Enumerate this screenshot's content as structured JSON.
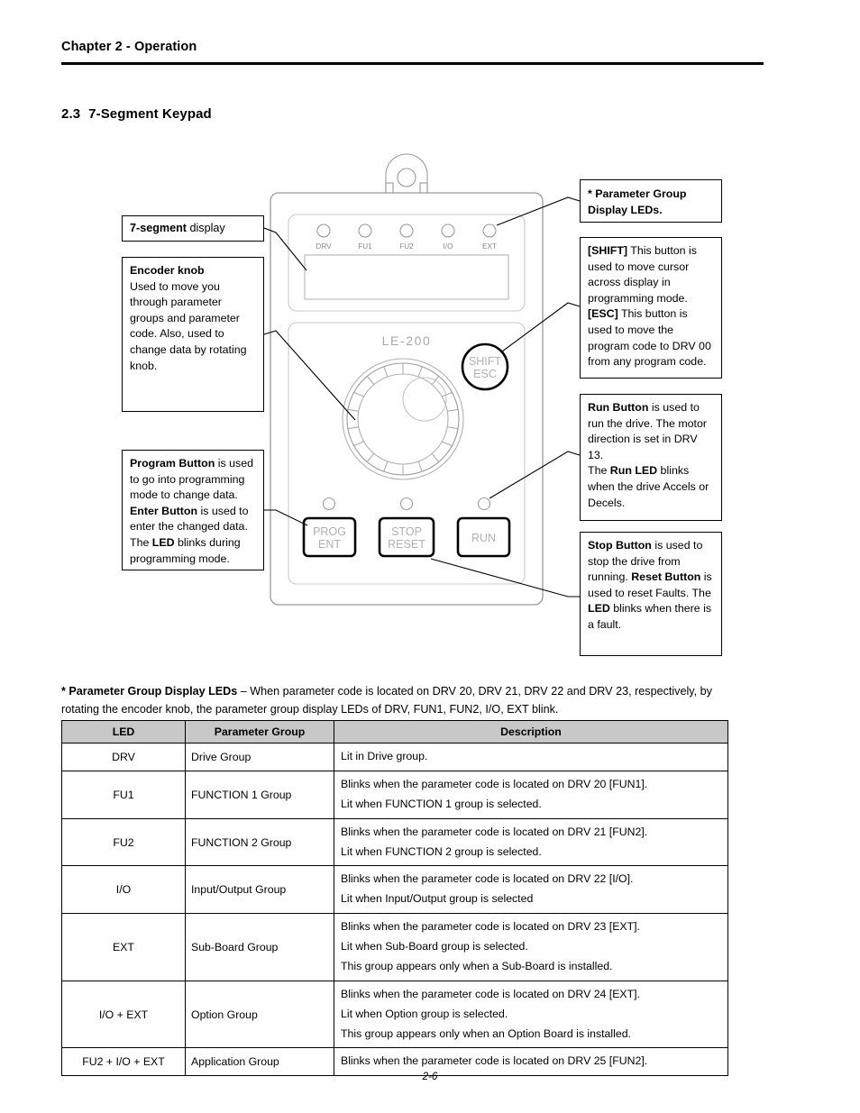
{
  "header": {
    "chapter": "Chapter 2 - Operation"
  },
  "section": {
    "number": "2.3",
    "title": "7-Segment Keypad"
  },
  "callouts": {
    "seven_segment": {
      "bold": "7-segment",
      "rest": " display"
    },
    "encoder_knob": {
      "title": "Encoder knob",
      "body": "Used to move you through parameter groups and parameter code. Also, used to change data by rotating knob."
    },
    "program_button": {
      "seg1_bold": "Program Button",
      "seg1": " is used to go into programming mode to change data. ",
      "seg2_bold": "Enter Button",
      "seg2": " is used to enter the changed data. The ",
      "seg3_bold": "LED",
      "seg3": " blinks during programming mode."
    },
    "parameter_group_leds": {
      "text": "* Parameter Group Display LEDs."
    },
    "shift_esc": {
      "seg1_bold": "[SHIFT]",
      "seg1": " This button is used to move cursor across display in programming mode. ",
      "seg2_bold": "[ESC]",
      "seg2": " This button is used to move the program code to DRV 00 from any program code."
    },
    "run_button": {
      "seg1_bold": "Run Button",
      "seg1": " is used to run the drive. The motor direction is set in DRV 13.",
      "seg2": "The ",
      "seg2_bold": "Run LED",
      "seg3": " blinks when the drive Accels or Decels."
    },
    "stop_button": {
      "seg1_bold": "Stop Button",
      "seg1": " is used to stop the drive from running. ",
      "seg2_bold": "Reset Button",
      "seg2": " is used to reset Faults. The ",
      "seg3_bold": "LED",
      "seg3": " blinks when there is a fault."
    }
  },
  "device": {
    "model_label": "LE-200",
    "leds": [
      "DRV",
      "FU1",
      "FU2",
      "I/O",
      "EXT"
    ],
    "shift_button": {
      "line1": "SHIFT",
      "line2": "ESC"
    },
    "buttons": [
      {
        "line1": "PROG",
        "line2": "ENT"
      },
      {
        "line1": "STOP",
        "line2": "RESET"
      },
      {
        "line1": "RUN",
        "line2": ""
      }
    ]
  },
  "note": {
    "bold": "* Parameter Group Display LEDs",
    "rest": " – When parameter code is located on DRV 20, DRV 21, DRV 22 and DRV 23, respectively, by rotating the encoder knob, the parameter group display LEDs of DRV, FUN1, FUN2, I/O, EXT blink."
  },
  "table": {
    "columns": [
      "LED",
      "Parameter Group",
      "Description"
    ],
    "rows": [
      {
        "led": "DRV",
        "group": "Drive Group",
        "description": [
          "Lit in Drive group."
        ]
      },
      {
        "led": "FU1",
        "group": "FUNCTION 1 Group",
        "description": [
          "Blinks when the parameter code is located on DRV 20 [FUN1].",
          "Lit when FUNCTION 1 group is selected."
        ]
      },
      {
        "led": "FU2",
        "group": "FUNCTION 2 Group",
        "description": [
          "Blinks when the parameter code is located on DRV 21 [FUN2].",
          "Lit when FUNCTION 2 group is selected."
        ]
      },
      {
        "led": "I/O",
        "group": "Input/Output Group",
        "description": [
          "Blinks when the parameter code is located on DRV 22 [I/O].",
          "Lit when Input/Output group is selected"
        ]
      },
      {
        "led": "EXT",
        "group": "Sub-Board Group",
        "description": [
          "Blinks when the parameter code is located on DRV 23 [EXT].",
          "Lit when Sub-Board group is selected.",
          "This group appears only when a Sub-Board is installed."
        ]
      },
      {
        "led": "I/O + EXT",
        "group": "Option Group",
        "description": [
          "Blinks when the parameter code is located on DRV 24 [EXT].",
          "Lit when Option group is selected.",
          "This group appears only when an Option Board is installed."
        ]
      },
      {
        "led": "FU2 + I/O + EXT",
        "group": "Application Group",
        "description": [
          "Blinks when the parameter code is located on DRV 25 [FUN2]."
        ]
      }
    ]
  },
  "footer": {
    "page_number": "2-6"
  },
  "colors": {
    "table_header_bg": "#c8c8c8",
    "line": "#000000",
    "device_outline": "#9a9a9a"
  }
}
